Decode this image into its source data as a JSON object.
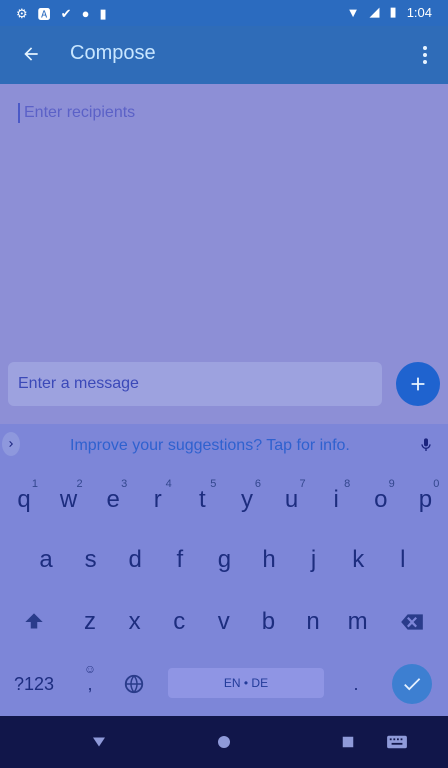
{
  "status": {
    "time": "1:04",
    "icons": [
      "settings-icon",
      "a-icon",
      "check-icon",
      "circle-icon",
      "sd-icon"
    ],
    "right_icons": [
      "wifi-icon",
      "signal-icon",
      "battery-icon"
    ]
  },
  "app_bar": {
    "title": "Compose",
    "back_icon": "back-arrow-icon",
    "menu_icon": "overflow-menu-icon"
  },
  "recipients": {
    "placeholder": "Enter recipients"
  },
  "message": {
    "placeholder": "Enter a message"
  },
  "keyboard": {
    "suggestion_text": "Improve your suggestions? Tap for info.",
    "row1": [
      {
        "k": "q",
        "h": "1"
      },
      {
        "k": "w",
        "h": "2"
      },
      {
        "k": "e",
        "h": "3"
      },
      {
        "k": "r",
        "h": "4"
      },
      {
        "k": "t",
        "h": "5"
      },
      {
        "k": "y",
        "h": "6"
      },
      {
        "k": "u",
        "h": "7"
      },
      {
        "k": "i",
        "h": "8"
      },
      {
        "k": "o",
        "h": "9"
      },
      {
        "k": "p",
        "h": "0"
      }
    ],
    "row2": [
      "a",
      "s",
      "d",
      "f",
      "g",
      "h",
      "j",
      "k",
      "l"
    ],
    "row3": [
      "z",
      "x",
      "c",
      "v",
      "b",
      "n",
      "m"
    ],
    "bottom": {
      "symbols": "?123",
      "comma": ",",
      "space": "EN • DE",
      "period": "."
    }
  },
  "colors": {
    "status_bar": "#2b6bbf",
    "app_bar": "#2f6cb8",
    "keyboard": "#7d86d8",
    "accent": "#1f63cf"
  }
}
